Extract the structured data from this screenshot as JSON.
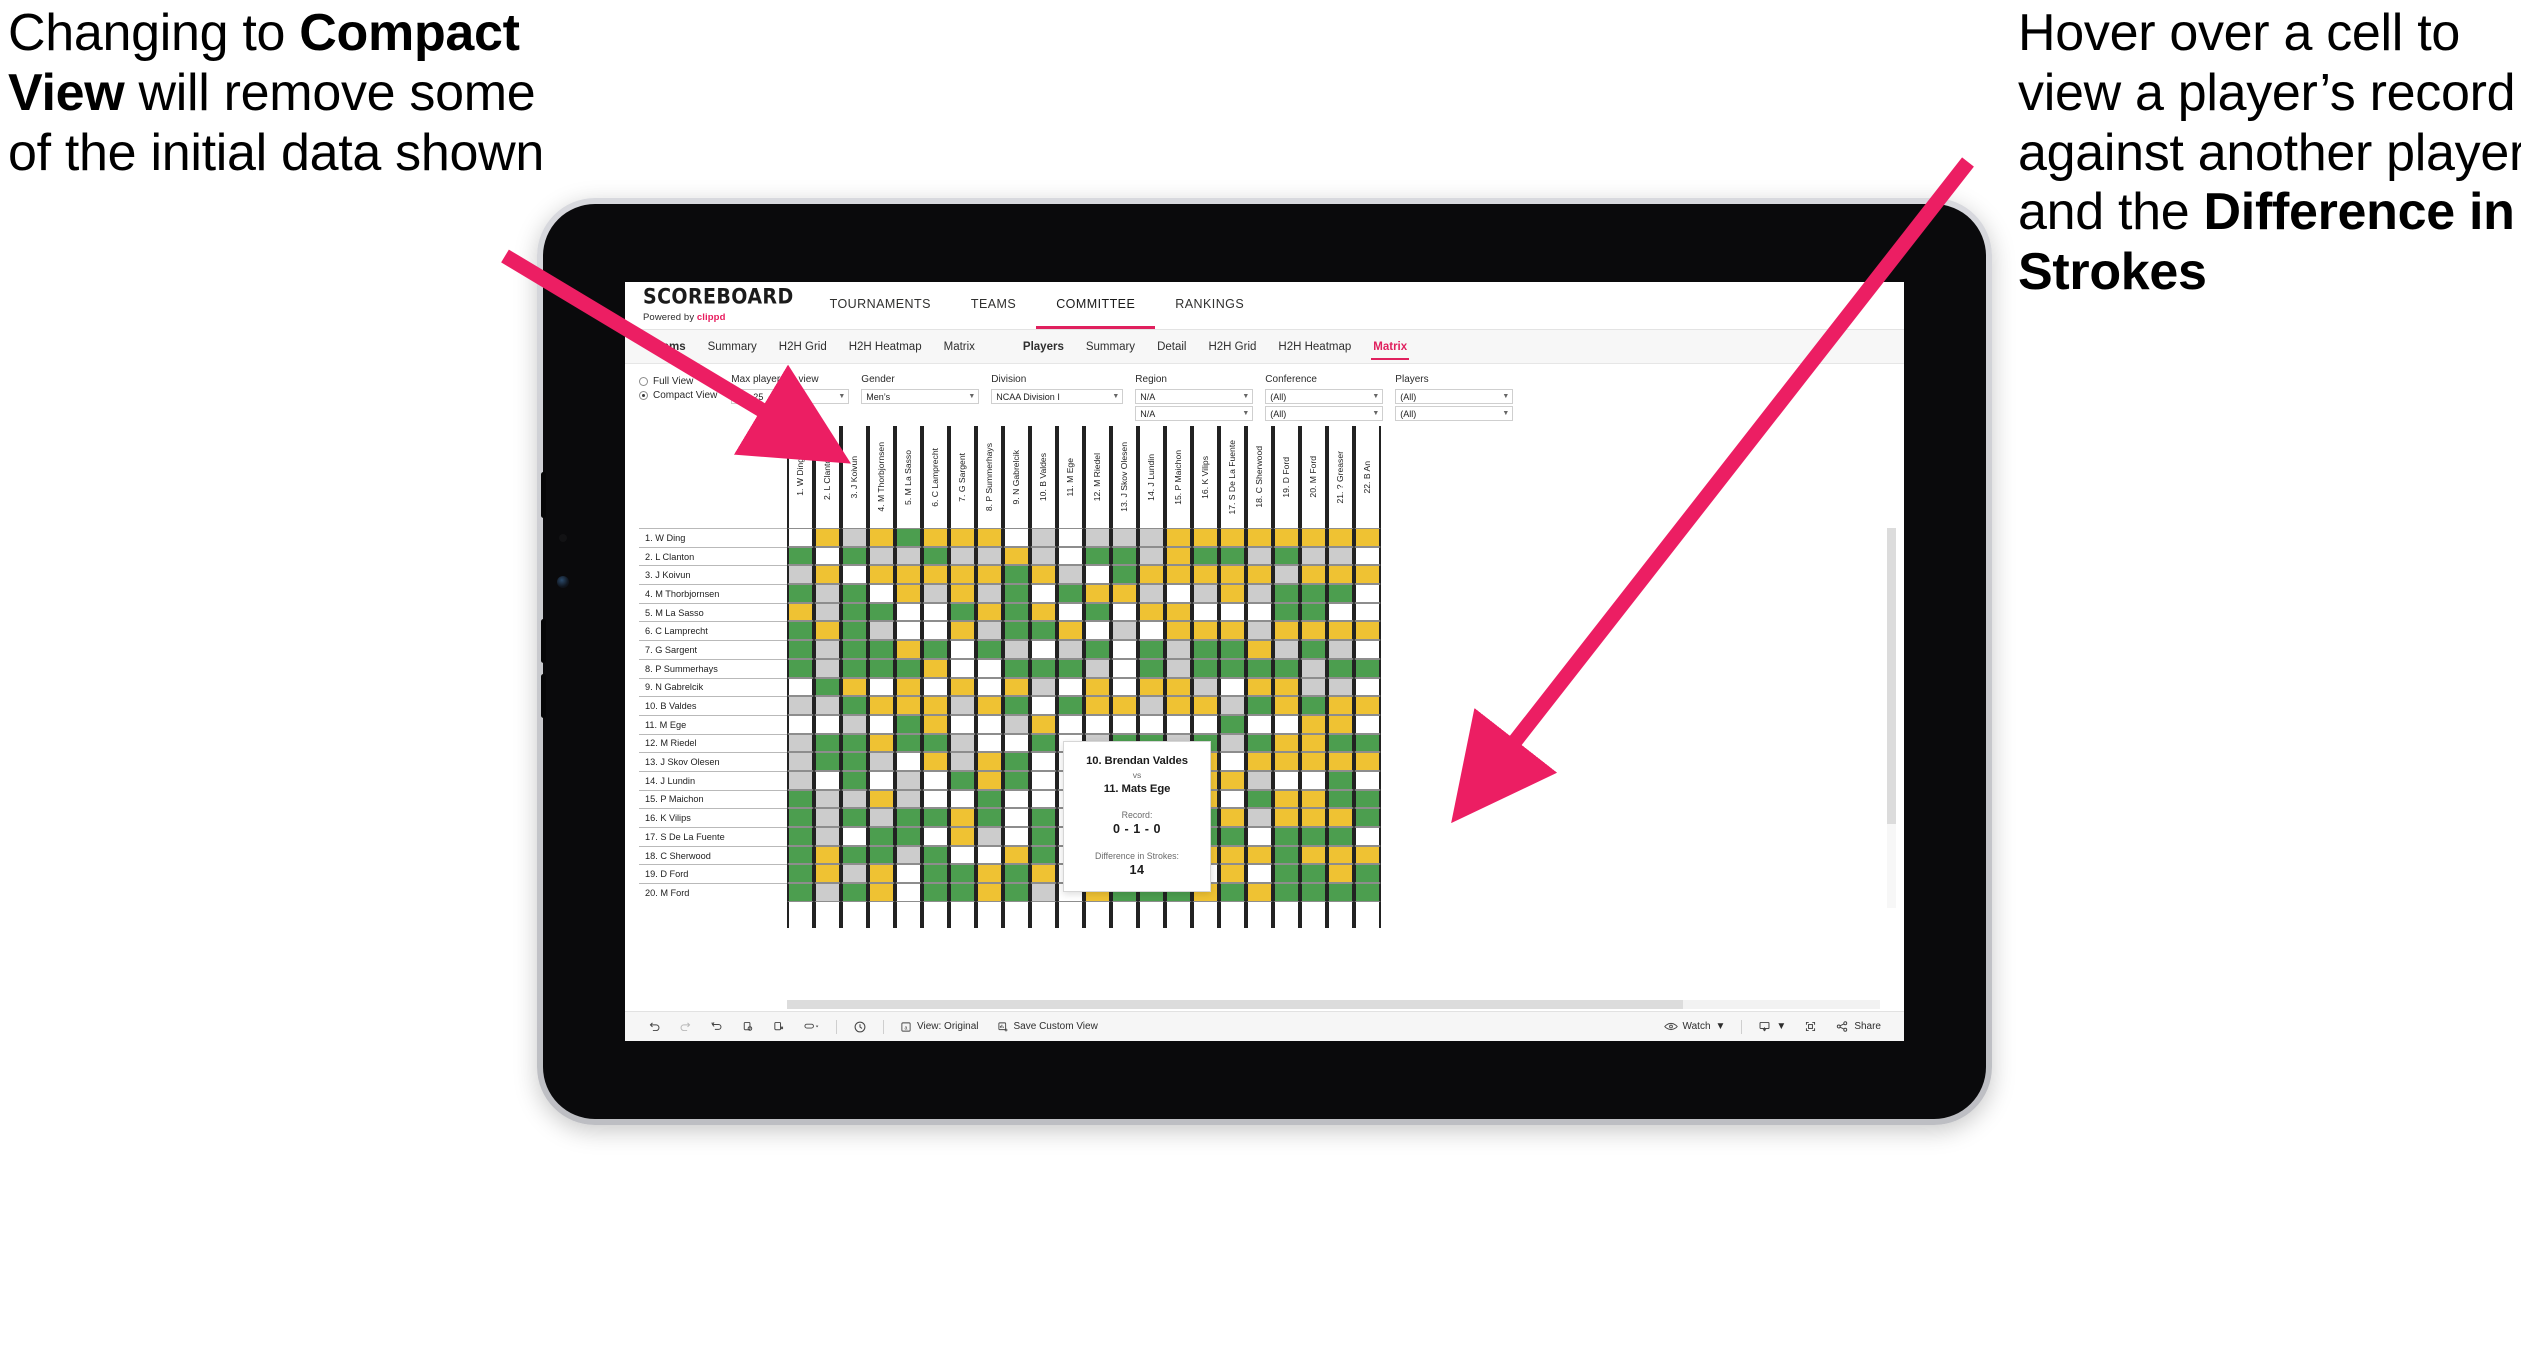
{
  "annotations": {
    "left": {
      "pre": "Changing to ",
      "bold": "Compact View",
      "post": " will remove some of the initial data shown"
    },
    "right": {
      "pre": "Hover over a cell to view a player’s record against another player and the ",
      "bold": "Difference in Strokes",
      "post": ""
    },
    "arrow_color": "#ec1e63"
  },
  "app": {
    "brand": {
      "word": "SCOREBOARD",
      "powered_prefix": "Powered by ",
      "powered_brand": "clippd"
    },
    "accent": "#e0205e",
    "top_tabs": [
      {
        "label": "TOURNAMENTS",
        "active": false
      },
      {
        "label": "TEAMS",
        "active": false
      },
      {
        "label": "COMMITTEE",
        "active": true
      },
      {
        "label": "RANKINGS",
        "active": false
      }
    ],
    "sub_tabs_group1": [
      {
        "label": "Teams",
        "active": false,
        "bold": true
      },
      {
        "label": "Summary",
        "active": false
      },
      {
        "label": "H2H Grid",
        "active": false
      },
      {
        "label": "H2H Heatmap",
        "active": false
      },
      {
        "label": "Matrix",
        "active": false
      }
    ],
    "sub_tabs_group2": [
      {
        "label": "Players",
        "active": false,
        "bold": true
      },
      {
        "label": "Summary",
        "active": false
      },
      {
        "label": "Detail",
        "active": false
      },
      {
        "label": "H2H Grid",
        "active": false
      },
      {
        "label": "H2H Heatmap",
        "active": false
      },
      {
        "label": "Matrix",
        "active": true
      }
    ]
  },
  "filters": {
    "view_mode": {
      "full_label": "Full View",
      "compact_label": "Compact View",
      "selected": "Compact View"
    },
    "max_players": {
      "label": "Max players in view",
      "value": "Top 25"
    },
    "gender": {
      "label": "Gender",
      "value": "Men’s"
    },
    "division": {
      "label": "Division",
      "value": "NCAA Division I"
    },
    "region": {
      "label": "Region",
      "value": "N/A",
      "value2": "N/A"
    },
    "conference": {
      "label": "Conference",
      "value": "(All)",
      "value2": "(All)"
    },
    "players": {
      "label": "Players",
      "value": "(All)",
      "value2": "(All)"
    }
  },
  "matrix": {
    "colors": {
      "win": "#4c9e4f",
      "tie": "#efc233",
      "loss": "#cccccc",
      "none": "#ffffff"
    },
    "rows": [
      "1. W Ding",
      "2. L Clanton",
      "3. J Koivun",
      "4. M Thorbjornsen",
      "5. M La Sasso",
      "6. C Lamprecht",
      "7. G Sargent",
      "8. P Summerhays",
      "9. N Gabrelcik",
      "10. B Valdes",
      "11. M Ege",
      "12. M Riedel",
      "13. J Skov Olesen",
      "14. J Lundin",
      "15. P Maichon",
      "16. K Vilips",
      "17. S De La Fuente",
      "18. C Sherwood",
      "19. D Ford",
      "20. M Ford"
    ],
    "columns": [
      "1. W Ding",
      "2. L Clanton",
      "3. J Koivun",
      "4. M Thorbjornsen",
      "5. M La Sasso",
      "6. C Lamprecht",
      "7. G Sargent",
      "8. P Summerhays",
      "9. N Gabrelcik",
      "10. B Valdes",
      "11. M Ege",
      "12. M Riedel",
      "13. J Skov Olesen",
      "14. J Lundin",
      "15. P Maichon",
      "16. K Vilips",
      "17. S De La Fuente",
      "18. C Sherwood",
      "19. D Ford",
      "20. M Ford",
      "21. ? Greaser",
      "22. B An"
    ],
    "cells": [
      [
        "n",
        "y",
        "l",
        "y",
        "g",
        "y",
        "y",
        "y",
        "n",
        "l",
        "n",
        "l",
        "l",
        "l",
        "y",
        "y",
        "y",
        "y",
        "y",
        "y",
        "y",
        "y"
      ],
      [
        "g",
        "n",
        "g",
        "l",
        "l",
        "g",
        "l",
        "l",
        "y",
        "l",
        "n",
        "g",
        "g",
        "l",
        "y",
        "g",
        "g",
        "l",
        "g",
        "l",
        "l",
        "n"
      ],
      [
        "l",
        "y",
        "n",
        "y",
        "y",
        "y",
        "y",
        "y",
        "g",
        "y",
        "l",
        "n",
        "g",
        "y",
        "y",
        "y",
        "y",
        "y",
        "l",
        "y",
        "y",
        "y"
      ],
      [
        "g",
        "l",
        "g",
        "n",
        "y",
        "l",
        "y",
        "l",
        "g",
        "n",
        "g",
        "y",
        "y",
        "l",
        "n",
        "l",
        "y",
        "l",
        "g",
        "g",
        "g",
        "n"
      ],
      [
        "y",
        "l",
        "g",
        "g",
        "n",
        "n",
        "g",
        "y",
        "g",
        "y",
        "n",
        "g",
        "n",
        "y",
        "y",
        "n",
        "n",
        "n",
        "g",
        "g",
        "n",
        "n"
      ],
      [
        "g",
        "y",
        "g",
        "l",
        "n",
        "n",
        "y",
        "l",
        "g",
        "g",
        "y",
        "n",
        "l",
        "n",
        "y",
        "y",
        "y",
        "l",
        "y",
        "y",
        "y",
        "y"
      ],
      [
        "g",
        "l",
        "g",
        "g",
        "y",
        "g",
        "n",
        "g",
        "l",
        "n",
        "l",
        "g",
        "n",
        "g",
        "l",
        "g",
        "g",
        "y",
        "l",
        "g",
        "l",
        "n"
      ],
      [
        "g",
        "l",
        "g",
        "g",
        "g",
        "y",
        "n",
        "n",
        "g",
        "g",
        "g",
        "l",
        "n",
        "g",
        "l",
        "g",
        "g",
        "g",
        "g",
        "l",
        "g",
        "g"
      ],
      [
        "n",
        "g",
        "y",
        "n",
        "y",
        "n",
        "y",
        "n",
        "y",
        "l",
        "n",
        "y",
        "n",
        "y",
        "y",
        "l",
        "n",
        "y",
        "y",
        "l",
        "l",
        "n"
      ],
      [
        "l",
        "l",
        "g",
        "y",
        "y",
        "y",
        "l",
        "y",
        "g",
        "n",
        "g",
        "y",
        "y",
        "l",
        "y",
        "y",
        "l",
        "g",
        "y",
        "g",
        "y",
        "y"
      ],
      [
        "n",
        "n",
        "l",
        "n",
        "g",
        "y",
        "n",
        "n",
        "l",
        "y",
        "n",
        "n",
        "n",
        "n",
        "n",
        "n",
        "g",
        "n",
        "n",
        "y",
        "y",
        "n"
      ],
      [
        "l",
        "g",
        "g",
        "y",
        "g",
        "g",
        "l",
        "n",
        "n",
        "g",
        "n",
        "l",
        "g",
        "g",
        "l",
        "g",
        "l",
        "g",
        "y",
        "y",
        "g",
        "g"
      ],
      [
        "l",
        "g",
        "g",
        "l",
        "n",
        "y",
        "l",
        "y",
        "g",
        "n",
        "n",
        "l",
        "y",
        "y",
        "l",
        "y",
        "n",
        "y",
        "y",
        "y",
        "y",
        "y"
      ],
      [
        "l",
        "n",
        "g",
        "n",
        "l",
        "n",
        "g",
        "y",
        "g",
        "n",
        "n",
        "y",
        "y",
        "y",
        "l",
        "y",
        "y",
        "l",
        "n",
        "n",
        "g",
        "n"
      ],
      [
        "g",
        "l",
        "l",
        "y",
        "l",
        "n",
        "n",
        "g",
        "n",
        "n",
        "n",
        "y",
        "g",
        "g",
        "l",
        "y",
        "n",
        "g",
        "y",
        "y",
        "g",
        "g"
      ],
      [
        "g",
        "l",
        "g",
        "l",
        "g",
        "g",
        "y",
        "g",
        "n",
        "g",
        "n",
        "l",
        "g",
        "n",
        "y",
        "g",
        "y",
        "l",
        "y",
        "y",
        "y",
        "g"
      ],
      [
        "g",
        "l",
        "n",
        "g",
        "g",
        "n",
        "y",
        "l",
        "n",
        "g",
        "n",
        "y",
        "y",
        "y",
        "y",
        "g",
        "g",
        "n",
        "g",
        "g",
        "g",
        "n"
      ],
      [
        "g",
        "y",
        "g",
        "g",
        "l",
        "g",
        "n",
        "n",
        "y",
        "g",
        "n",
        "y",
        "l",
        "g",
        "y",
        "y",
        "y",
        "y",
        "g",
        "y",
        "y",
        "y"
      ],
      [
        "g",
        "y",
        "l",
        "y",
        "n",
        "g",
        "g",
        "y",
        "g",
        "y",
        "n",
        "g",
        "g",
        "g",
        "y",
        "n",
        "y",
        "n",
        "g",
        "g",
        "y",
        "g"
      ],
      [
        "g",
        "l",
        "g",
        "y",
        "n",
        "g",
        "g",
        "y",
        "g",
        "l",
        "n",
        "y",
        "g",
        "g",
        "g",
        "y",
        "g",
        "y",
        "g",
        "g",
        "g",
        "g"
      ]
    ]
  },
  "tooltip": {
    "player_a": "10. Brendan Valdes",
    "vs": "vs",
    "player_b": "11. Mats Ege",
    "record_label": "Record:",
    "record_value": "0 - 1 - 0",
    "strokes_label": "Difference in Strokes:",
    "strokes_value": "14"
  },
  "toolbar": {
    "items": [
      {
        "name": "undo-icon",
        "label": ""
      },
      {
        "name": "redo-icon",
        "label": ""
      },
      {
        "name": "revert-icon",
        "label": ""
      },
      {
        "name": "refresh-data-icon",
        "label": ""
      },
      {
        "name": "pause-updates-icon",
        "label": ""
      },
      {
        "name": "highlight-icon",
        "label": ""
      }
    ],
    "view_original": "View: Original",
    "save_custom_view": "Save Custom View",
    "watch": "Watch",
    "share": "Share"
  }
}
